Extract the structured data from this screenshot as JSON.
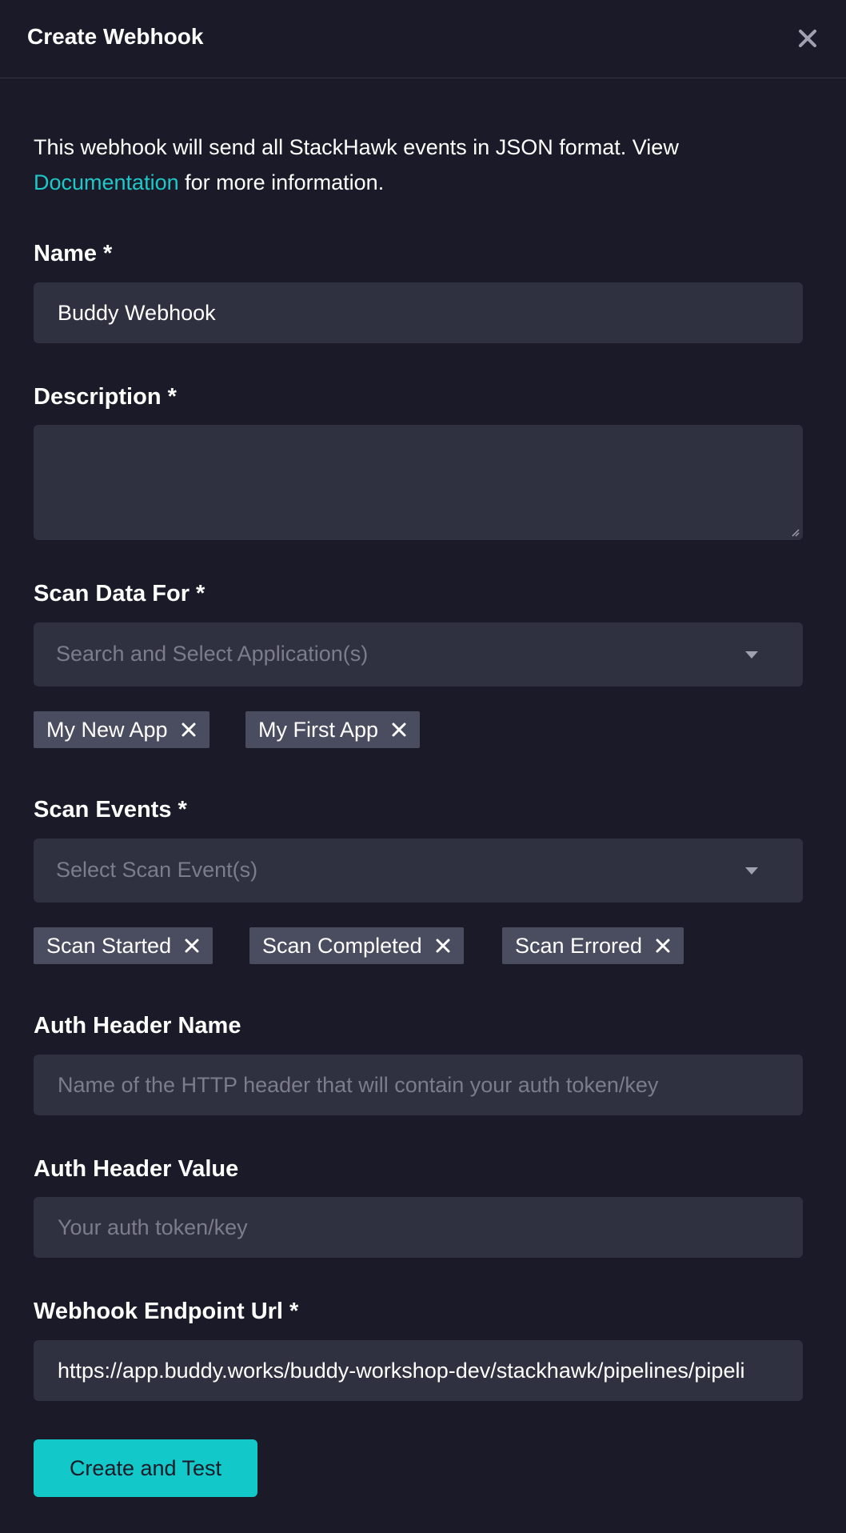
{
  "modal": {
    "title": "Create Webhook"
  },
  "intro": {
    "text_before": "This webhook will send all StackHawk events in JSON format. View ",
    "link": "Documentation",
    "text_after": " for more information."
  },
  "name_field": {
    "label": "Name *",
    "value": "Buddy Webhook"
  },
  "description_field": {
    "label": "Description *",
    "value": ""
  },
  "scan_data_for": {
    "label": "Scan Data For *",
    "placeholder": "Search and Select Application(s)",
    "selected": [
      "My New App",
      "My First App"
    ]
  },
  "scan_events": {
    "label": "Scan Events *",
    "placeholder": "Select Scan Event(s)",
    "selected": [
      "Scan Started",
      "Scan Completed",
      "Scan Errored"
    ]
  },
  "auth_header_name": {
    "label": "Auth Header Name",
    "placeholder": "Name of the HTTP header that will contain your auth token/key",
    "value": ""
  },
  "auth_header_value": {
    "label": "Auth Header Value",
    "placeholder": "Your auth token/key",
    "value": ""
  },
  "endpoint_url": {
    "label": "Webhook Endpoint Url *",
    "value": "https://app.buddy.works/buddy-workshop-dev/stackhawk/pipelines/pipeli"
  },
  "actions": {
    "submit_label": "Create and Test"
  },
  "colors": {
    "background": "#1b1a28",
    "input_bg": "#2f3040",
    "chip_bg": "#4a4c60",
    "accent": "#13c8c8",
    "link": "#1ec8c8"
  }
}
